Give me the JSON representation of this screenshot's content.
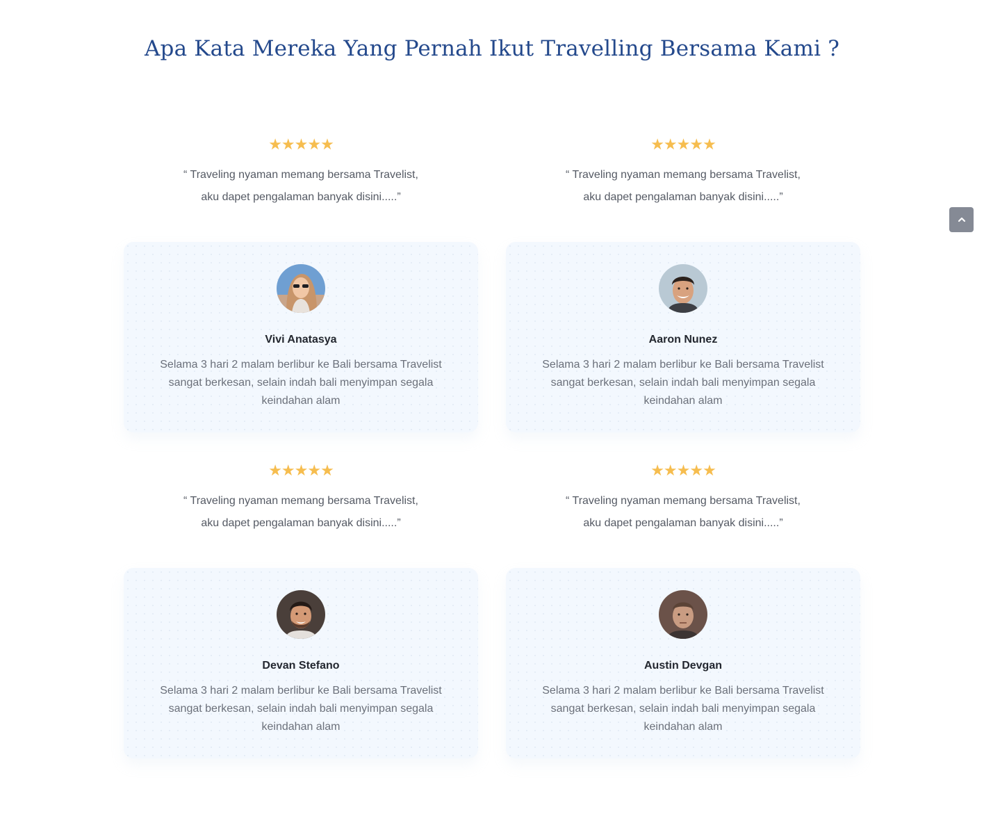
{
  "section": {
    "title": "Apa Kata Mereka Yang Pernah Ikut Travelling Bersama Kami ?"
  },
  "testimonials": [
    {
      "rating": 5,
      "stars": "★★★★★",
      "quote_line1": "“ Traveling nyaman memang bersama Travelist,",
      "quote_line2": "aku dapet pengalaman banyak disini.....”",
      "name": "Vivi Anatasya",
      "review": "Selama 3 hari 2 malam berlibur ke Bali bersama Travelist sangat berkesan, selain indah bali menyimpan segala keindahan alam"
    },
    {
      "rating": 5,
      "stars": "★★★★★",
      "quote_line1": "“ Traveling nyaman memang bersama Travelist,",
      "quote_line2": "aku dapet pengalaman banyak disini.....”",
      "name": "Aaron Nunez",
      "review": "Selama 3 hari 2 malam berlibur ke Bali bersama Travelist sangat berkesan, selain indah bali menyimpan segala keindahan alam"
    },
    {
      "rating": 5,
      "stars": "★★★★★",
      "quote_line1": "“ Traveling nyaman memang bersama Travelist,",
      "quote_line2": "aku dapet pengalaman banyak disini.....”",
      "name": "Devan Stefano",
      "review": "Selama 3 hari 2 malam berlibur ke Bali bersama Travelist sangat berkesan, selain indah bali menyimpan segala keindahan alam"
    },
    {
      "rating": 5,
      "stars": "★★★★★",
      "quote_line1": "“ Traveling nyaman memang bersama Travelist,",
      "quote_line2": "aku dapet pengalaman banyak disini.....”",
      "name": "Austin Devgan",
      "review": "Selama 3 hari 2 malam berlibur ke Bali bersama Travelist sangat berkesan, selain indah bali menyimpan segala keindahan alam"
    }
  ],
  "scroll_top": {
    "icon": "chevron-up-icon"
  },
  "colors": {
    "title": "#24498c",
    "star": "#f6bd4f",
    "card_bg": "#f3f8fe",
    "scroll_button": "#858a95"
  }
}
